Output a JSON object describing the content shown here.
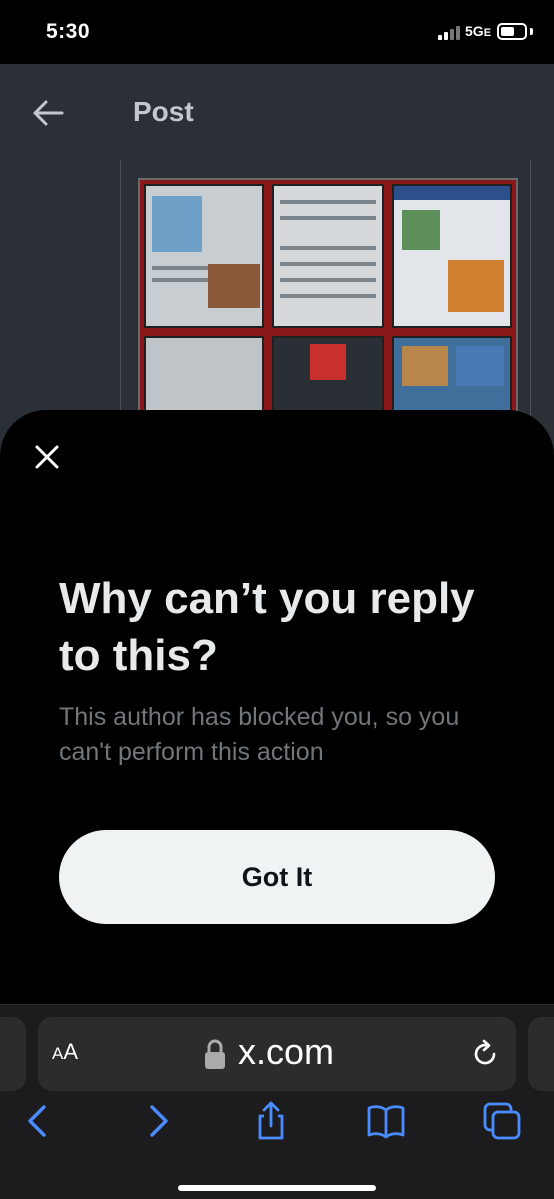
{
  "status_bar": {
    "time": "5:30",
    "network": "5G",
    "network_suffix": "E"
  },
  "background_post": {
    "back_icon": "arrow-left-icon",
    "title": "Post"
  },
  "sheet": {
    "close_icon": "close-icon",
    "title": "Why can’t you reply to this?",
    "body": "This author has blocked you, so you can't perform this action",
    "button_label": "Got It"
  },
  "browser": {
    "aa_large": "A",
    "aa_small": "A",
    "url": "x.com",
    "icons": [
      "lock-icon",
      "reload-icon",
      "chevron-left-icon",
      "chevron-right-icon",
      "share-icon",
      "bookmarks-icon",
      "tabs-icon"
    ]
  },
  "colors": {
    "accent": "#4a8cff",
    "button_bg": "#eff3f4",
    "body_text": "#71767b"
  }
}
